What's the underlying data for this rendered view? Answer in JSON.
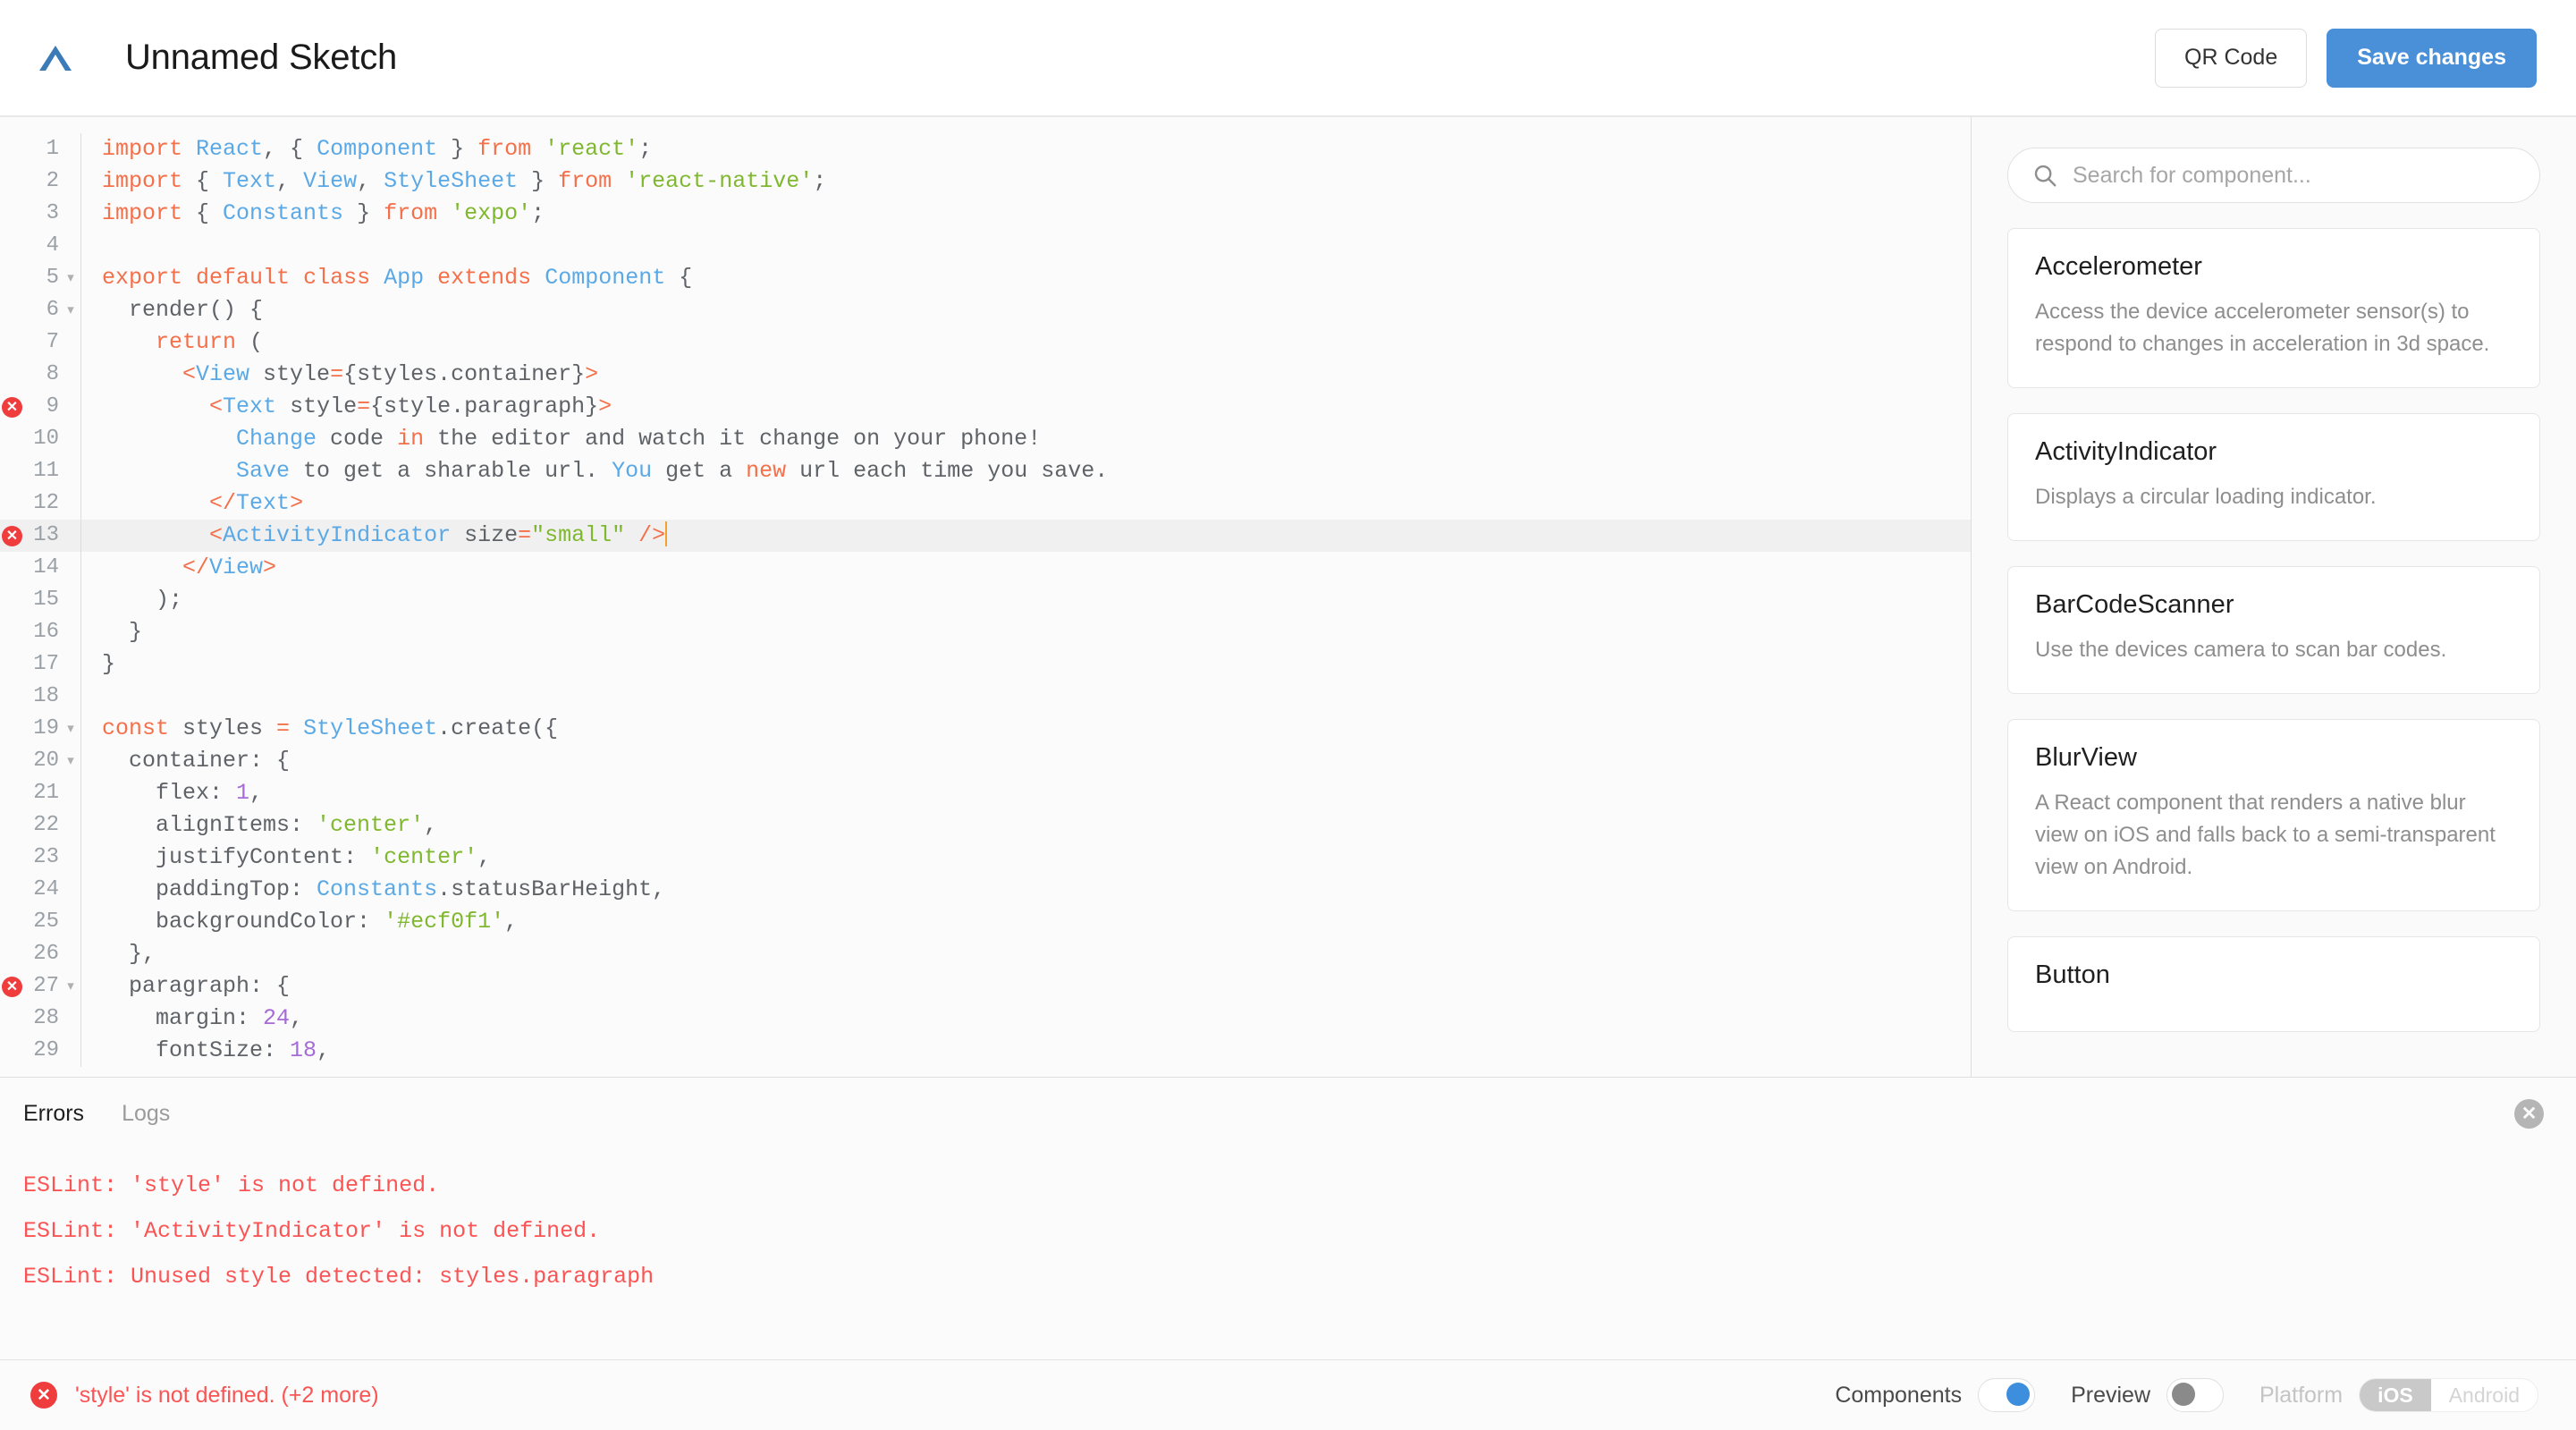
{
  "header": {
    "logo_icon": "expo-chevron-logo",
    "title": "Unnamed Sketch",
    "qr_label": "QR Code",
    "save_label": "Save changes",
    "accent_color": "#4a90d9"
  },
  "editor": {
    "language": "jsx",
    "active_line": 13,
    "lines": [
      {
        "num": 1,
        "fold": false,
        "error": false,
        "tokens": [
          {
            "t": "import",
            "c": "kw"
          },
          {
            "t": " ",
            "c": "plain"
          },
          {
            "t": "React",
            "c": "cls"
          },
          {
            "t": ", { ",
            "c": "punc"
          },
          {
            "t": "Component",
            "c": "cls"
          },
          {
            "t": " } ",
            "c": "punc"
          },
          {
            "t": "from",
            "c": "kw"
          },
          {
            "t": " ",
            "c": "plain"
          },
          {
            "t": "'react'",
            "c": "str"
          },
          {
            "t": ";",
            "c": "punc"
          }
        ]
      },
      {
        "num": 2,
        "fold": false,
        "error": false,
        "tokens": [
          {
            "t": "import",
            "c": "kw"
          },
          {
            "t": " { ",
            "c": "punc"
          },
          {
            "t": "Text",
            "c": "cls"
          },
          {
            "t": ", ",
            "c": "punc"
          },
          {
            "t": "View",
            "c": "cls"
          },
          {
            "t": ", ",
            "c": "punc"
          },
          {
            "t": "StyleSheet",
            "c": "cls"
          },
          {
            "t": " } ",
            "c": "punc"
          },
          {
            "t": "from",
            "c": "kw"
          },
          {
            "t": " ",
            "c": "plain"
          },
          {
            "t": "'react-native'",
            "c": "str"
          },
          {
            "t": ";",
            "c": "punc"
          }
        ]
      },
      {
        "num": 3,
        "fold": false,
        "error": false,
        "tokens": [
          {
            "t": "import",
            "c": "kw"
          },
          {
            "t": " { ",
            "c": "punc"
          },
          {
            "t": "Constants",
            "c": "cls"
          },
          {
            "t": " } ",
            "c": "punc"
          },
          {
            "t": "from",
            "c": "kw"
          },
          {
            "t": " ",
            "c": "plain"
          },
          {
            "t": "'expo'",
            "c": "str"
          },
          {
            "t": ";",
            "c": "punc"
          }
        ]
      },
      {
        "num": 4,
        "fold": false,
        "error": false,
        "tokens": []
      },
      {
        "num": 5,
        "fold": true,
        "error": false,
        "tokens": [
          {
            "t": "export",
            "c": "kw"
          },
          {
            "t": " ",
            "c": "plain"
          },
          {
            "t": "default",
            "c": "kw"
          },
          {
            "t": " ",
            "c": "plain"
          },
          {
            "t": "class",
            "c": "kw"
          },
          {
            "t": " ",
            "c": "plain"
          },
          {
            "t": "App",
            "c": "cls"
          },
          {
            "t": " ",
            "c": "plain"
          },
          {
            "t": "extends",
            "c": "kw"
          },
          {
            "t": " ",
            "c": "plain"
          },
          {
            "t": "Component",
            "c": "cls"
          },
          {
            "t": " {",
            "c": "punc"
          }
        ]
      },
      {
        "num": 6,
        "fold": true,
        "error": false,
        "tokens": [
          {
            "t": "  ",
            "c": "plain"
          },
          {
            "t": "render",
            "c": "plain"
          },
          {
            "t": "() {",
            "c": "punc"
          }
        ]
      },
      {
        "num": 7,
        "fold": false,
        "error": false,
        "tokens": [
          {
            "t": "    ",
            "c": "plain"
          },
          {
            "t": "return",
            "c": "kw"
          },
          {
            "t": " (",
            "c": "punc"
          }
        ]
      },
      {
        "num": 8,
        "fold": false,
        "error": false,
        "tokens": [
          {
            "t": "      ",
            "c": "plain"
          },
          {
            "t": "<",
            "c": "tag"
          },
          {
            "t": "View",
            "c": "comp"
          },
          {
            "t": " style",
            "c": "attr"
          },
          {
            "t": "=",
            "c": "tag"
          },
          {
            "t": "{styles.container}",
            "c": "attr"
          },
          {
            "t": ">",
            "c": "tag"
          }
        ]
      },
      {
        "num": 9,
        "fold": false,
        "error": true,
        "tokens": [
          {
            "t": "        ",
            "c": "plain"
          },
          {
            "t": "<",
            "c": "tag"
          },
          {
            "t": "Text",
            "c": "comp"
          },
          {
            "t": " style",
            "c": "attr"
          },
          {
            "t": "=",
            "c": "tag"
          },
          {
            "t": "{style.paragraph}",
            "c": "attr"
          },
          {
            "t": ">",
            "c": "tag"
          }
        ]
      },
      {
        "num": 10,
        "fold": false,
        "error": false,
        "tokens": [
          {
            "t": "          ",
            "c": "plain"
          },
          {
            "t": "Change",
            "c": "cls"
          },
          {
            "t": " code ",
            "c": "plain"
          },
          {
            "t": "in",
            "c": "kw"
          },
          {
            "t": " the editor and watch it change on your phone!",
            "c": "plain"
          }
        ]
      },
      {
        "num": 11,
        "fold": false,
        "error": false,
        "tokens": [
          {
            "t": "          ",
            "c": "plain"
          },
          {
            "t": "Save",
            "c": "cls"
          },
          {
            "t": " to get a sharable url. ",
            "c": "plain"
          },
          {
            "t": "You",
            "c": "cls"
          },
          {
            "t": " get a ",
            "c": "plain"
          },
          {
            "t": "new",
            "c": "kw"
          },
          {
            "t": " url each time you save.",
            "c": "plain"
          }
        ]
      },
      {
        "num": 12,
        "fold": false,
        "error": false,
        "tokens": [
          {
            "t": "        ",
            "c": "plain"
          },
          {
            "t": "</",
            "c": "tag"
          },
          {
            "t": "Text",
            "c": "comp"
          },
          {
            "t": ">",
            "c": "tag"
          }
        ]
      },
      {
        "num": 13,
        "fold": false,
        "error": true,
        "cursor": true,
        "tokens": [
          {
            "t": "        ",
            "c": "plain"
          },
          {
            "t": "<",
            "c": "tag"
          },
          {
            "t": "ActivityIndicator",
            "c": "comp"
          },
          {
            "t": " size",
            "c": "attr"
          },
          {
            "t": "=",
            "c": "tag"
          },
          {
            "t": "\"small\"",
            "c": "str"
          },
          {
            "t": " ",
            "c": "plain"
          },
          {
            "t": "/>",
            "c": "tag"
          }
        ]
      },
      {
        "num": 14,
        "fold": false,
        "error": false,
        "tokens": [
          {
            "t": "      ",
            "c": "plain"
          },
          {
            "t": "</",
            "c": "tag"
          },
          {
            "t": "View",
            "c": "comp"
          },
          {
            "t": ">",
            "c": "tag"
          }
        ]
      },
      {
        "num": 15,
        "fold": false,
        "error": false,
        "tokens": [
          {
            "t": "    );",
            "c": "punc"
          }
        ]
      },
      {
        "num": 16,
        "fold": false,
        "error": false,
        "tokens": [
          {
            "t": "  }",
            "c": "punc"
          }
        ]
      },
      {
        "num": 17,
        "fold": false,
        "error": false,
        "tokens": [
          {
            "t": "}",
            "c": "punc"
          }
        ]
      },
      {
        "num": 18,
        "fold": false,
        "error": false,
        "tokens": []
      },
      {
        "num": 19,
        "fold": true,
        "error": false,
        "tokens": [
          {
            "t": "const",
            "c": "kw"
          },
          {
            "t": " styles ",
            "c": "plain"
          },
          {
            "t": "=",
            "c": "tag"
          },
          {
            "t": " ",
            "c": "plain"
          },
          {
            "t": "StyleSheet",
            "c": "cls"
          },
          {
            "t": ".create({",
            "c": "punc"
          }
        ]
      },
      {
        "num": 20,
        "fold": true,
        "error": false,
        "tokens": [
          {
            "t": "  container: {",
            "c": "punc"
          }
        ]
      },
      {
        "num": 21,
        "fold": false,
        "error": false,
        "tokens": [
          {
            "t": "    flex: ",
            "c": "punc"
          },
          {
            "t": "1",
            "c": "num"
          },
          {
            "t": ",",
            "c": "punc"
          }
        ]
      },
      {
        "num": 22,
        "fold": false,
        "error": false,
        "tokens": [
          {
            "t": "    alignItems: ",
            "c": "punc"
          },
          {
            "t": "'center'",
            "c": "str"
          },
          {
            "t": ",",
            "c": "punc"
          }
        ]
      },
      {
        "num": 23,
        "fold": false,
        "error": false,
        "tokens": [
          {
            "t": "    justifyContent: ",
            "c": "punc"
          },
          {
            "t": "'center'",
            "c": "str"
          },
          {
            "t": ",",
            "c": "punc"
          }
        ]
      },
      {
        "num": 24,
        "fold": false,
        "error": false,
        "tokens": [
          {
            "t": "    paddingTop: ",
            "c": "punc"
          },
          {
            "t": "Constants",
            "c": "cls"
          },
          {
            "t": ".statusBarHeight,",
            "c": "punc"
          }
        ]
      },
      {
        "num": 25,
        "fold": false,
        "error": false,
        "tokens": [
          {
            "t": "    backgroundColor: ",
            "c": "punc"
          },
          {
            "t": "'#ecf0f1'",
            "c": "str"
          },
          {
            "t": ",",
            "c": "punc"
          }
        ]
      },
      {
        "num": 26,
        "fold": false,
        "error": false,
        "tokens": [
          {
            "t": "  },",
            "c": "punc"
          }
        ]
      },
      {
        "num": 27,
        "fold": true,
        "error": true,
        "tokens": [
          {
            "t": "  paragraph: {",
            "c": "punc"
          }
        ]
      },
      {
        "num": 28,
        "fold": false,
        "error": false,
        "tokens": [
          {
            "t": "    margin: ",
            "c": "punc"
          },
          {
            "t": "24",
            "c": "num"
          },
          {
            "t": ",",
            "c": "punc"
          }
        ]
      },
      {
        "num": 29,
        "fold": false,
        "error": false,
        "tokens": [
          {
            "t": "    fontSize: ",
            "c": "punc"
          },
          {
            "t": "18",
            "c": "num"
          },
          {
            "t": ",",
            "c": "punc"
          }
        ]
      }
    ]
  },
  "sidebar": {
    "search_placeholder": "Search for component...",
    "search_value": "",
    "search_icon": "magnifier-icon",
    "components": [
      {
        "name": "Accelerometer",
        "desc": "Access the device accelerometer sensor(s) to respond to changes in acceleration in 3d space."
      },
      {
        "name": "ActivityIndicator",
        "desc": "Displays a circular loading indicator."
      },
      {
        "name": "BarCodeScanner",
        "desc": "Use the devices camera to scan bar codes."
      },
      {
        "name": "BlurView",
        "desc": "A React component that renders a native blur view on iOS and falls back to a semi-transparent view on Android."
      },
      {
        "name": "Button",
        "desc": ""
      }
    ]
  },
  "panel": {
    "tabs": [
      {
        "label": "Errors",
        "active": true
      },
      {
        "label": "Logs",
        "active": false
      }
    ],
    "close_icon": "close-circle-icon",
    "errors": [
      "ESLint: 'style' is not defined.",
      "ESLint: 'ActivityIndicator' is not defined.",
      "ESLint: Unused style detected: styles.paragraph"
    ]
  },
  "statusbar": {
    "error_icon": "error-circle-icon",
    "error_text": "'style' is not defined. (+2 more)",
    "error_color": "#fb5454",
    "components_label": "Components",
    "components_on": true,
    "preview_label": "Preview",
    "preview_on": false,
    "platform_label": "Platform",
    "platform_options": [
      {
        "label": "iOS",
        "active": true
      },
      {
        "label": "Android",
        "active": false
      }
    ]
  }
}
